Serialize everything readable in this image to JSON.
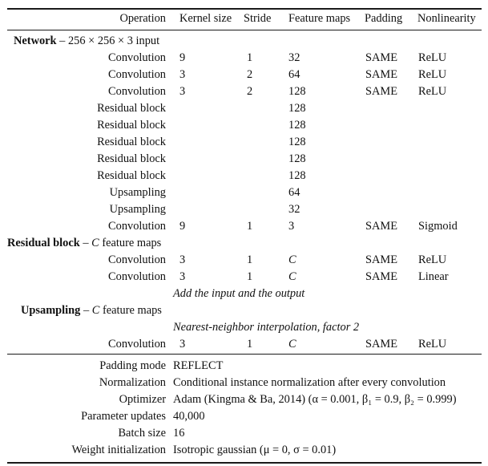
{
  "table": {
    "headers": [
      "Operation",
      "Kernel size",
      "Stride",
      "Feature maps",
      "Padding",
      "Nonlinearity"
    ],
    "sections": [
      {
        "title_bold": "Network",
        "title_rest": " – 256 × 256 × 3 input",
        "rows": [
          {
            "operation": "Convolution",
            "kernel": "9",
            "stride": "1",
            "maps": "32",
            "padding": "SAME",
            "nonlinearity": "ReLU"
          },
          {
            "operation": "Convolution",
            "kernel": "3",
            "stride": "2",
            "maps": "64",
            "padding": "SAME",
            "nonlinearity": "ReLU"
          },
          {
            "operation": "Convolution",
            "kernel": "3",
            "stride": "2",
            "maps": "128",
            "padding": "SAME",
            "nonlinearity": "ReLU"
          },
          {
            "operation": "Residual block",
            "kernel": "",
            "stride": "",
            "maps": "128",
            "padding": "",
            "nonlinearity": ""
          },
          {
            "operation": "Residual block",
            "kernel": "",
            "stride": "",
            "maps": "128",
            "padding": "",
            "nonlinearity": ""
          },
          {
            "operation": "Residual block",
            "kernel": "",
            "stride": "",
            "maps": "128",
            "padding": "",
            "nonlinearity": ""
          },
          {
            "operation": "Residual block",
            "kernel": "",
            "stride": "",
            "maps": "128",
            "padding": "",
            "nonlinearity": ""
          },
          {
            "operation": "Residual block",
            "kernel": "",
            "stride": "",
            "maps": "128",
            "padding": "",
            "nonlinearity": ""
          },
          {
            "operation": "Upsampling",
            "kernel": "",
            "stride": "",
            "maps": "64",
            "padding": "",
            "nonlinearity": ""
          },
          {
            "operation": "Upsampling",
            "kernel": "",
            "stride": "",
            "maps": "32",
            "padding": "",
            "nonlinearity": ""
          },
          {
            "operation": "Convolution",
            "kernel": "9",
            "stride": "1",
            "maps": "3",
            "padding": "SAME",
            "nonlinearity": "Sigmoid"
          }
        ]
      },
      {
        "title_bold": "Residual block",
        "title_rest": " – C feature maps",
        "rows": [
          {
            "operation": "Convolution",
            "kernel": "3",
            "stride": "1",
            "maps": "C",
            "padding": "SAME",
            "nonlinearity": "ReLU"
          },
          {
            "operation": "Convolution",
            "kernel": "3",
            "stride": "1",
            "maps": "C",
            "padding": "SAME",
            "nonlinearity": "Linear"
          }
        ],
        "note": "Add the input and the output"
      },
      {
        "title_bold": "Upsampling",
        "title_rest": " – C feature maps",
        "note": "Nearest-neighbor interpolation, factor 2",
        "rows": [
          {
            "operation": "Convolution",
            "kernel": "3",
            "stride": "1",
            "maps": "C",
            "padding": "SAME",
            "nonlinearity": "ReLU"
          }
        ]
      }
    ],
    "settings": [
      {
        "label": "Padding mode",
        "value": "REFLECT"
      },
      {
        "label": "Normalization",
        "value": "Conditional instance normalization after every convolution"
      },
      {
        "label": "Optimizer",
        "value": "Adam (Kingma & Ba, 2014) (α = 0.001, β₁ = 0.9, β₂ = 0.999)"
      },
      {
        "label": "Parameter updates",
        "value": "40,000"
      },
      {
        "label": "Batch size",
        "value": "16"
      },
      {
        "label": "Weight initialization",
        "value": "Isotropic gaussian (μ = 0, σ = 0.01)"
      }
    ]
  }
}
